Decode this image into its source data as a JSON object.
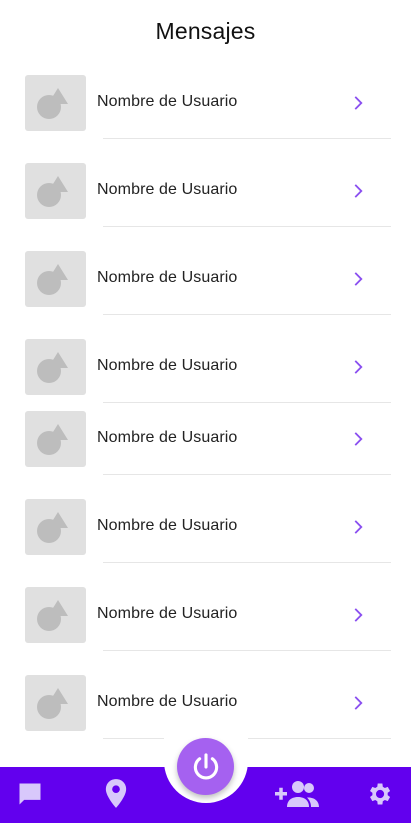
{
  "header": {
    "title": "Mensajes"
  },
  "messages": [
    {
      "name": "Nombre de Usuario"
    },
    {
      "name": "Nombre de Usuario"
    },
    {
      "name": "Nombre de Usuario"
    },
    {
      "name": "Nombre de Usuario"
    },
    {
      "name": "Nombre de Usuario"
    },
    {
      "name": "Nombre de Usuario"
    },
    {
      "name": "Nombre de Usuario"
    },
    {
      "name": "Nombre de Usuario"
    }
  ],
  "icons": {
    "avatar": "image-placeholder-icon",
    "row_action": "chevron-right-icon",
    "fab": "power-icon",
    "nav": [
      "chat-icon",
      "location-pin-icon",
      "add-group-icon",
      "gear-icon"
    ]
  },
  "colors": {
    "primary": "#6200ee",
    "fab": "#a561f0",
    "chevron": "#8a4ff0",
    "placeholder_bg": "#e0e0e0",
    "placeholder_shape": "#bdbdbd"
  }
}
